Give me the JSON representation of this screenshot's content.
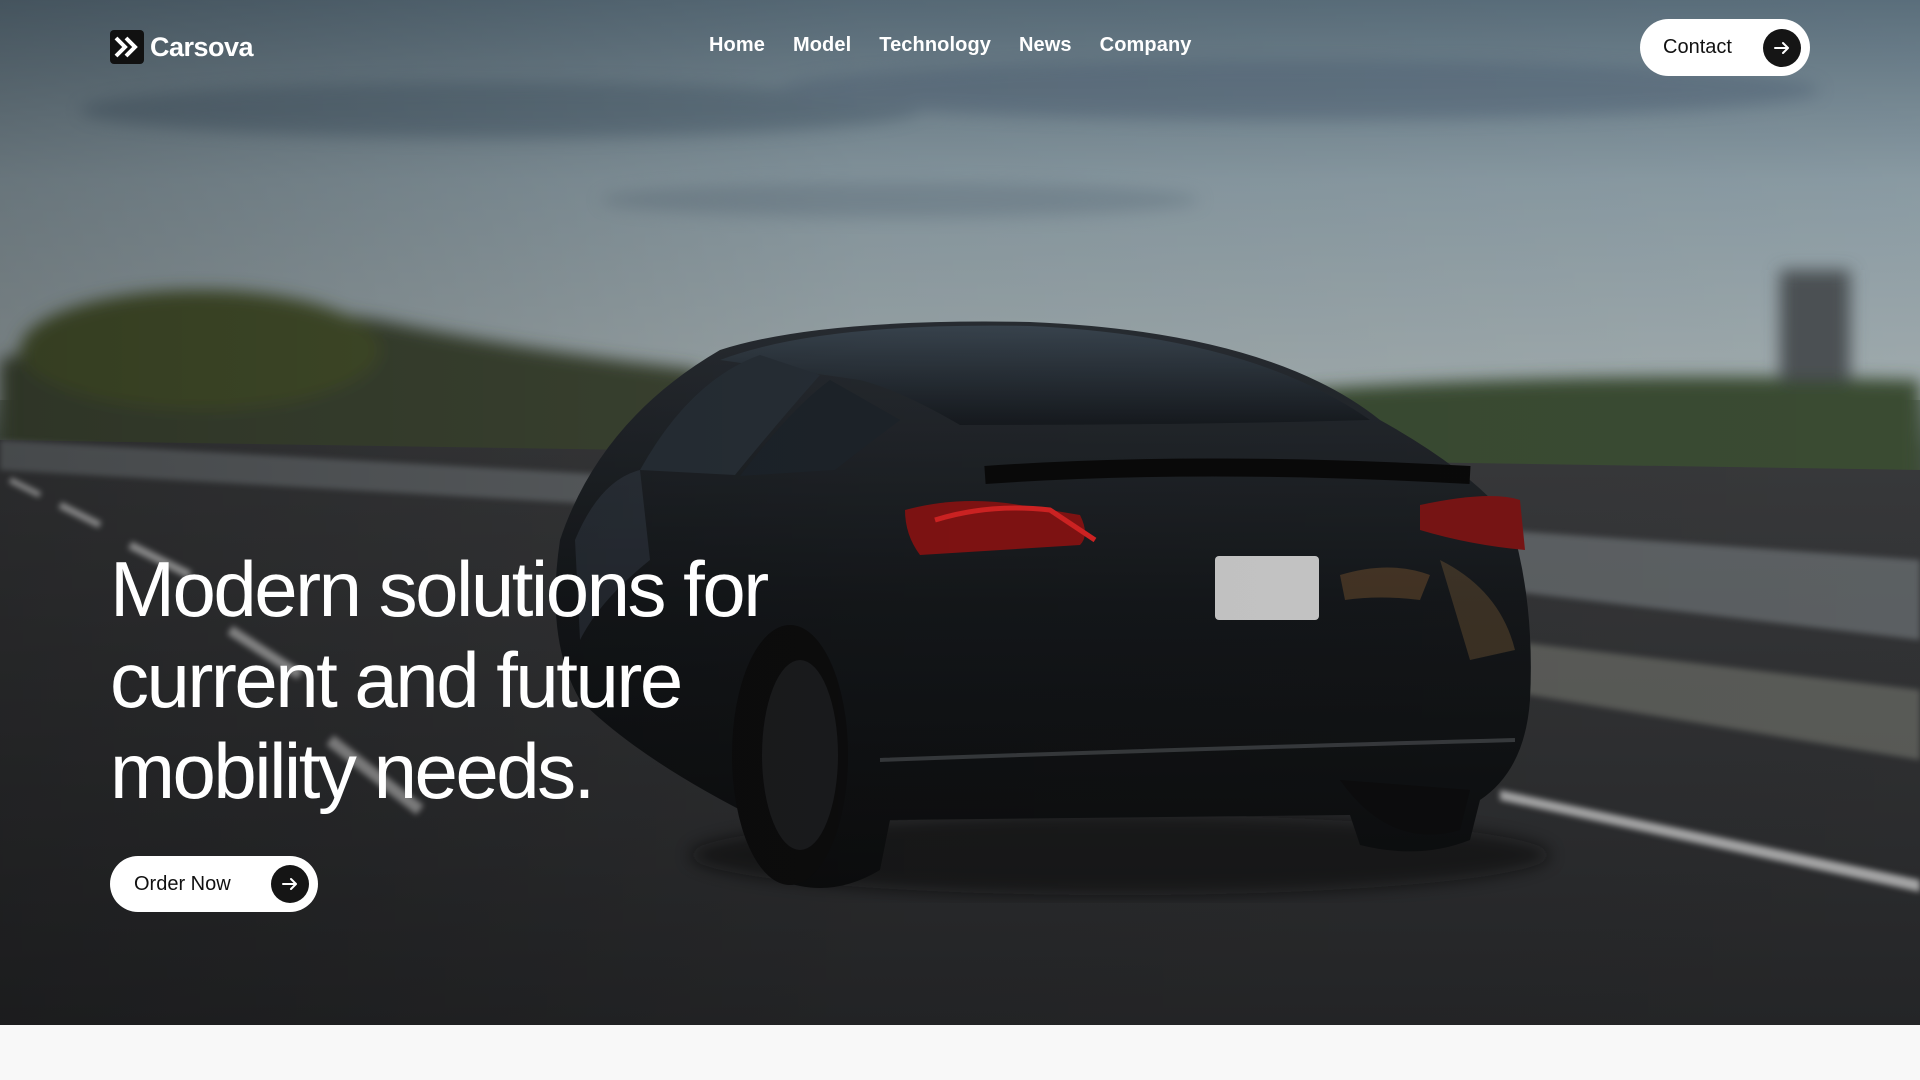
{
  "brand": {
    "name": "Carsova"
  },
  "nav": {
    "items": [
      {
        "label": "Home"
      },
      {
        "label": "Model"
      },
      {
        "label": "Technology"
      },
      {
        "label": "News"
      },
      {
        "label": "Company"
      }
    ],
    "contact_label": "Contact"
  },
  "hero": {
    "headline": "Modern solutions for current and future mobility needs.",
    "cta_label": "Order Now"
  },
  "icons": {
    "logo": "double-chevron-right-icon",
    "cta_arrow": "arrow-right-icon"
  },
  "colors": {
    "button_bg": "#ffffff",
    "arrow_circle": "#151515",
    "text_light": "#ffffff"
  }
}
